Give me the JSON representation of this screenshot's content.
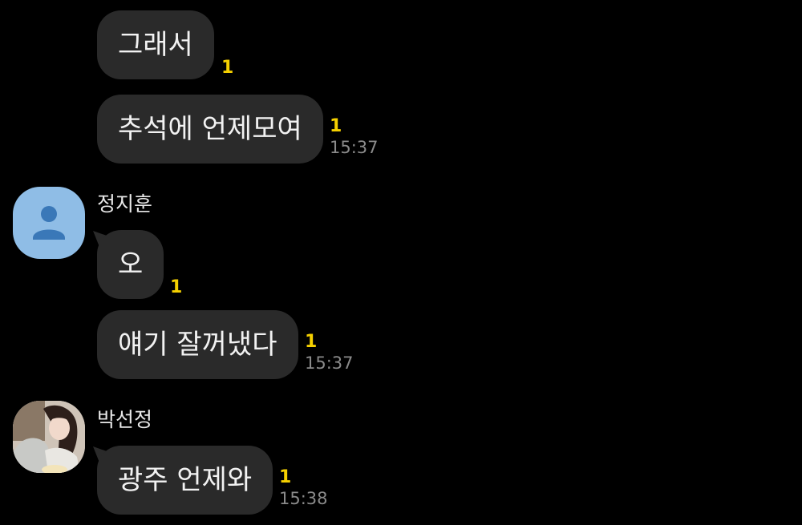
{
  "colors": {
    "background": "#000000",
    "bubble": "#2a2a2a",
    "unread": "#f5d000",
    "timestamp": "#8a8a8a",
    "default_avatar_bg": "#8fbde6"
  },
  "messages": [
    {
      "text": "그래서",
      "unread": "1",
      "time": ""
    },
    {
      "text": "추석에 언제모여",
      "unread": "1",
      "time": "15:37"
    }
  ],
  "groups": [
    {
      "sender": "정지훈",
      "avatar_icon": "default-person-icon",
      "messages": [
        {
          "text": "오",
          "unread": "1",
          "time": ""
        },
        {
          "text": "얘기 잘꺼냈다",
          "unread": "1",
          "time": "15:37"
        }
      ]
    },
    {
      "sender": "박선정",
      "avatar_icon": "profile-photo",
      "messages": [
        {
          "text": "광주 언제와",
          "unread": "1",
          "time": "15:38"
        }
      ]
    }
  ]
}
